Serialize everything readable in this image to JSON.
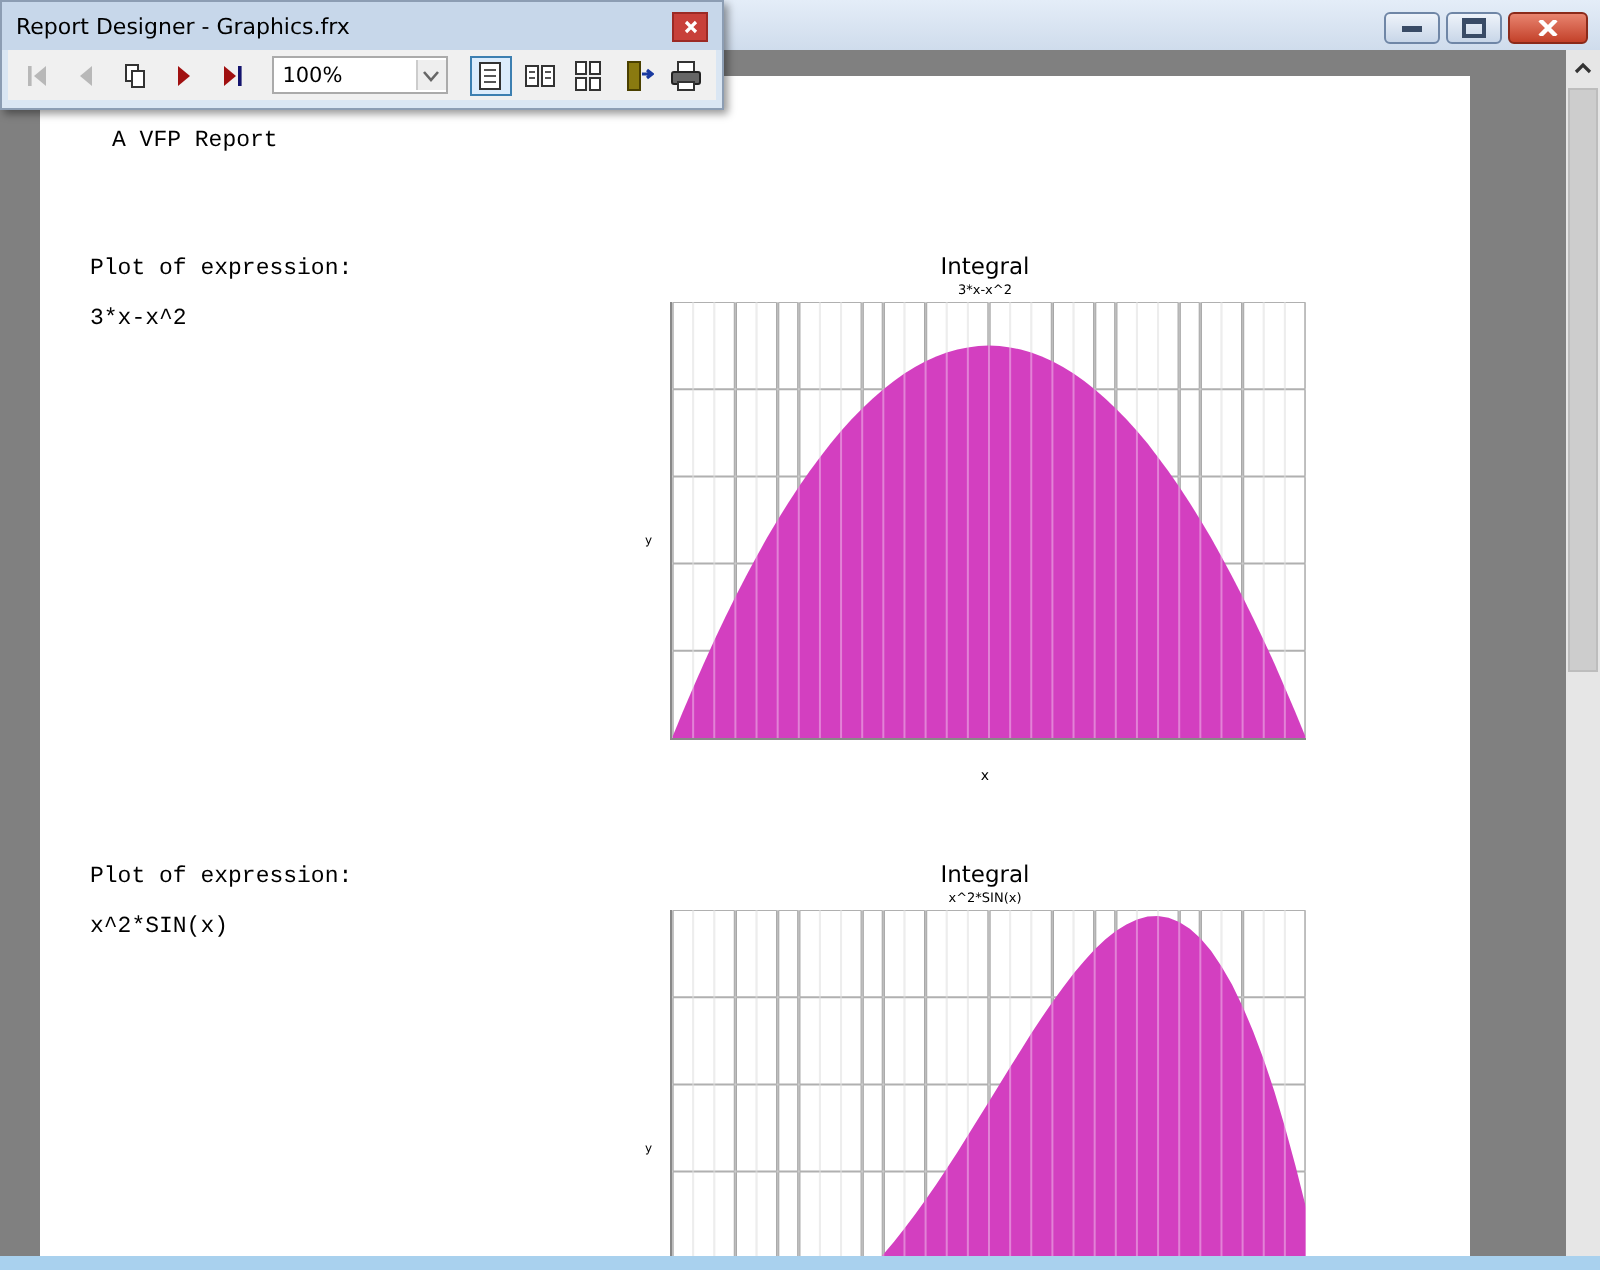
{
  "toolbar": {
    "title": "Report Designer - Graphics.frx",
    "zoom": "100%",
    "nav": [
      {
        "kind": "first",
        "disabled": true
      },
      {
        "kind": "previous",
        "disabled": true
      },
      {
        "kind": "goto",
        "disabled": false
      },
      {
        "kind": "next",
        "disabled": false
      },
      {
        "kind": "last",
        "disabled": false
      }
    ],
    "views": [
      {
        "kind": "one",
        "selected": true
      },
      {
        "kind": "two",
        "selected": false
      },
      {
        "kind": "multi",
        "selected": false
      }
    ],
    "actions": [
      {
        "kind": "exit"
      },
      {
        "kind": "print"
      }
    ]
  },
  "report": {
    "heading": "A VFP Report",
    "sections": [
      {
        "label": "Plot of expression:",
        "expression": "3*x-x^2",
        "chart": {
          "title": "Integral",
          "subtitle": "3*x-x^2",
          "xlabel": "x",
          "ylabel": "y",
          "kind": "parabola"
        }
      },
      {
        "label": "Plot of expression:",
        "expression": "x^2*SIN(x)",
        "chart": {
          "title": "Integral",
          "subtitle": "x^2*SIN(x)",
          "ylabel": "y",
          "kind": "sine"
        }
      }
    ]
  }
}
